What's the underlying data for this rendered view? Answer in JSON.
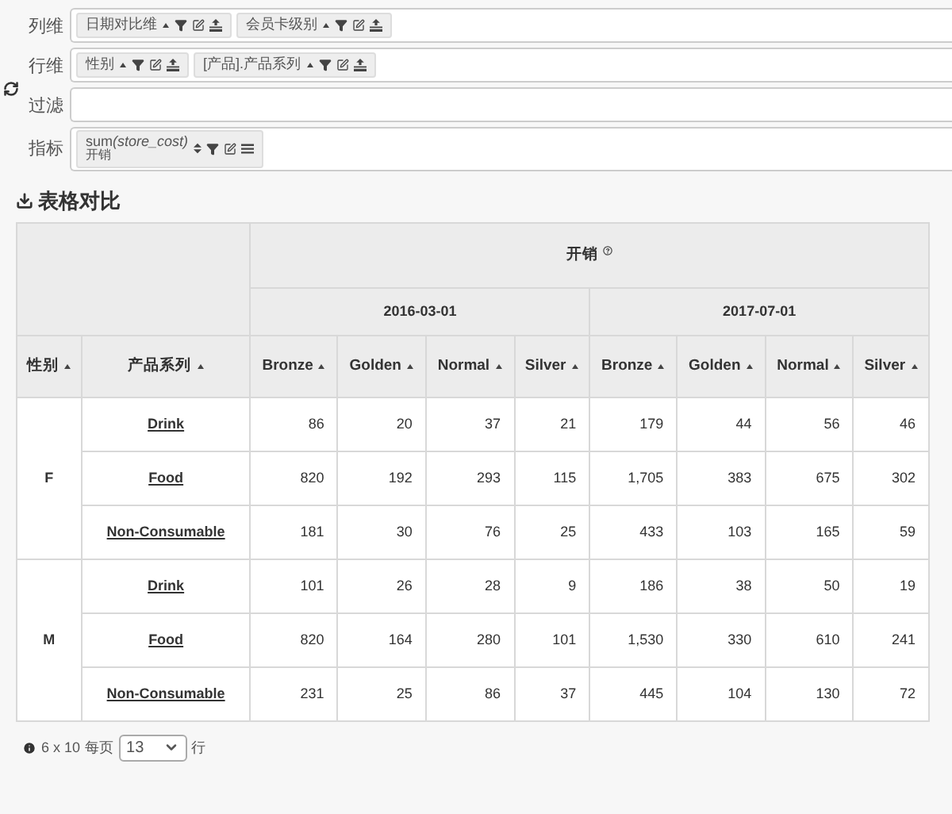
{
  "config": [
    {
      "label": "列维",
      "tags": [
        {
          "kind": "dimension",
          "text": "日期对比维"
        },
        {
          "kind": "dimension",
          "text": "会员卡级别"
        }
      ]
    },
    {
      "label": "行维",
      "tags": [
        {
          "kind": "dimension",
          "text": "性别"
        },
        {
          "kind": "dimension",
          "text": "[产品].产品系列"
        }
      ]
    },
    {
      "label": "过滤"
    },
    {
      "label": "指标",
      "tags": [
        {
          "kind": "measure",
          "text": "sum",
          "arg": "(store_cost)",
          "sub": "开销"
        }
      ]
    }
  ],
  "title": "表格对比",
  "table": {
    "measure": "开销",
    "dates": [
      {
        "label": "2016-03-01",
        "levels": [
          "Bronze",
          "Golden",
          "Normal",
          "Silver"
        ]
      },
      {
        "label": "2017-07-01",
        "levels": [
          "Bronze",
          "Golden",
          "Normal",
          "Silver"
        ]
      }
    ],
    "row_headers": [
      "性别",
      "产品系列"
    ],
    "groups": [
      {
        "label": "F",
        "rows": [
          {
            "name": "Drink",
            "values": [
              "86",
              "20",
              "37",
              "21",
              "179",
              "44",
              "56",
              "46"
            ]
          },
          {
            "name": "Food",
            "values": [
              "820",
              "192",
              "293",
              "115",
              "1,705",
              "383",
              "675",
              "302"
            ]
          },
          {
            "name": "Non-Consumable",
            "values": [
              "181",
              "30",
              "76",
              "25",
              "433",
              "103",
              "165",
              "59"
            ]
          }
        ]
      },
      {
        "label": "M",
        "rows": [
          {
            "name": "Drink",
            "values": [
              "101",
              "26",
              "28",
              "9",
              "186",
              "38",
              "50",
              "19"
            ]
          },
          {
            "name": "Food",
            "values": [
              "820",
              "164",
              "280",
              "101",
              "1,530",
              "330",
              "610",
              "241"
            ]
          },
          {
            "name": "Non-Consumable",
            "values": [
              "231",
              "25",
              "86",
              "37",
              "445",
              "104",
              "130",
              "72"
            ]
          }
        ]
      }
    ]
  },
  "footer": {
    "size": "6 x 10",
    "per_page": "每页",
    "page_size": "13",
    "unit": "行"
  }
}
